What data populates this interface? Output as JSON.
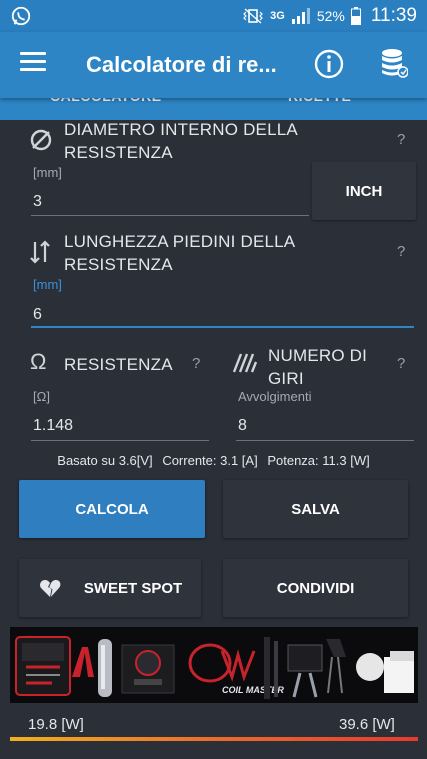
{
  "status": {
    "network": "3G",
    "battery": "52%",
    "time": "11:39"
  },
  "appbar": {
    "title": "Calcolatore di re..."
  },
  "tabs": [
    "CALCOLATORE",
    "RICETTE"
  ],
  "diameter": {
    "title_line1": "DIAMETRO INTERNO DELLA",
    "title_line2": "RESISTENZA",
    "unit": "[mm]",
    "value": "3",
    "help": "?",
    "inch_button": "INCH"
  },
  "legs": {
    "title_line1": "LUNGHEZZA PIEDINI DELLA",
    "title_line2": "RESISTENZA",
    "unit": "[mm]",
    "value": "6",
    "help": "?"
  },
  "resistance": {
    "title": "RESISTENZA",
    "unit": "[Ω]",
    "value": "1.148",
    "help": "?",
    "symbol": "Ω"
  },
  "wraps": {
    "title_line1": "NUMERO DI",
    "title_line2": "GIRI",
    "unit": "Avvolgimenti",
    "value": "8",
    "help": "?"
  },
  "info": {
    "based": "Basato su 3.6[V]",
    "current": "Corrente: 3.1 [A]",
    "power": "Potenza: 11.3 [W]"
  },
  "buttons": {
    "calculate": "CALCOLA",
    "save": "SALVA",
    "sweet_spot": "SWEET SPOT",
    "share": "CONDIVIDI"
  },
  "banner": {
    "brand": "COIL MASTER"
  },
  "range": {
    "min": "19.8 [W]",
    "max": "39.6 [W]"
  },
  "colors": {
    "primary": "#2d85c6",
    "background": "#2b2f38",
    "gradient_start": "#f2b020",
    "gradient_end": "#e53b2e"
  }
}
